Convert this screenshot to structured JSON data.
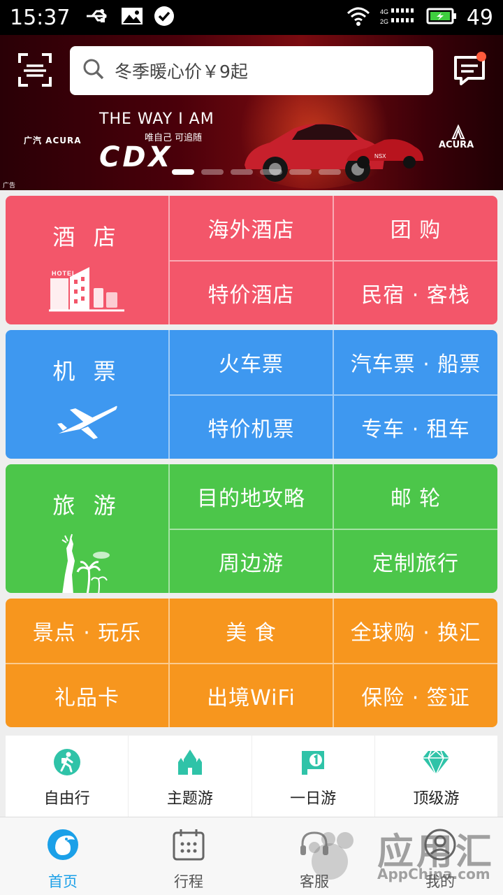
{
  "status_bar": {
    "time": "15:37",
    "battery": "49",
    "icons": [
      "usb-icon",
      "image-icon",
      "check-circle-icon",
      "wifi-icon",
      "signal-4g-icon",
      "battery-icon"
    ],
    "network_labels": [
      "4G",
      "2G"
    ]
  },
  "header": {
    "search_placeholder": "冬季暖心价￥9起",
    "icons": [
      "scan-icon",
      "search-icon",
      "message-icon"
    ]
  },
  "banner": {
    "brand_left": "广汽 ACURA",
    "tagline": "THE WAY I AM",
    "sub_tagline": "唯自己 可追随",
    "model": "CDX",
    "brand_right": "ACURA",
    "car_label": "NSX",
    "ad_label": "广告",
    "slide_count": 6,
    "active_slide": 1
  },
  "sections": {
    "hotel": {
      "main": "酒 店",
      "main_icon": "hotel-icon",
      "sign": "HOTEL",
      "items": [
        "海外酒店",
        "团 购",
        "特价酒店",
        "民宿 · 客栈"
      ],
      "color": "#f3566a"
    },
    "flight": {
      "main": "机 票",
      "main_icon": "airplane-icon",
      "items": [
        "火车票",
        "汽车票 · 船票",
        "特价机票",
        "专车 · 租车"
      ],
      "color": "#3e98f0"
    },
    "travel": {
      "main": "旅 游",
      "main_icon": "statue-of-liberty-icon",
      "items": [
        "目的地攻略",
        "邮 轮",
        "周边游",
        "定制旅行"
      ],
      "color": "#4cc64a"
    },
    "more": {
      "items": [
        "景点 · 玩乐",
        "美 食",
        "全球购 · 换汇",
        "礼品卡",
        "出境WiFi",
        "保险 · 签证"
      ],
      "color": "#f7961e"
    }
  },
  "quick_entries": [
    {
      "label": "自由行",
      "icon": "backpacker-icon"
    },
    {
      "label": "主题游",
      "icon": "castle-icon"
    },
    {
      "label": "一日游",
      "icon": "one-day-flag-icon"
    },
    {
      "label": "顶级游",
      "icon": "diamond-icon"
    }
  ],
  "tab_bar": {
    "tabs": [
      {
        "label": "首页",
        "icon": "dolphin-home-icon",
        "active": true
      },
      {
        "label": "行程",
        "icon": "calendar-icon",
        "active": false
      },
      {
        "label": "客服",
        "icon": "headset-icon",
        "active": false
      },
      {
        "label": "我的",
        "icon": "user-icon",
        "active": false
      }
    ],
    "active_color": "#1ba0e8"
  },
  "watermark": {
    "text": "应用汇",
    "sub": "AppChina.com"
  }
}
